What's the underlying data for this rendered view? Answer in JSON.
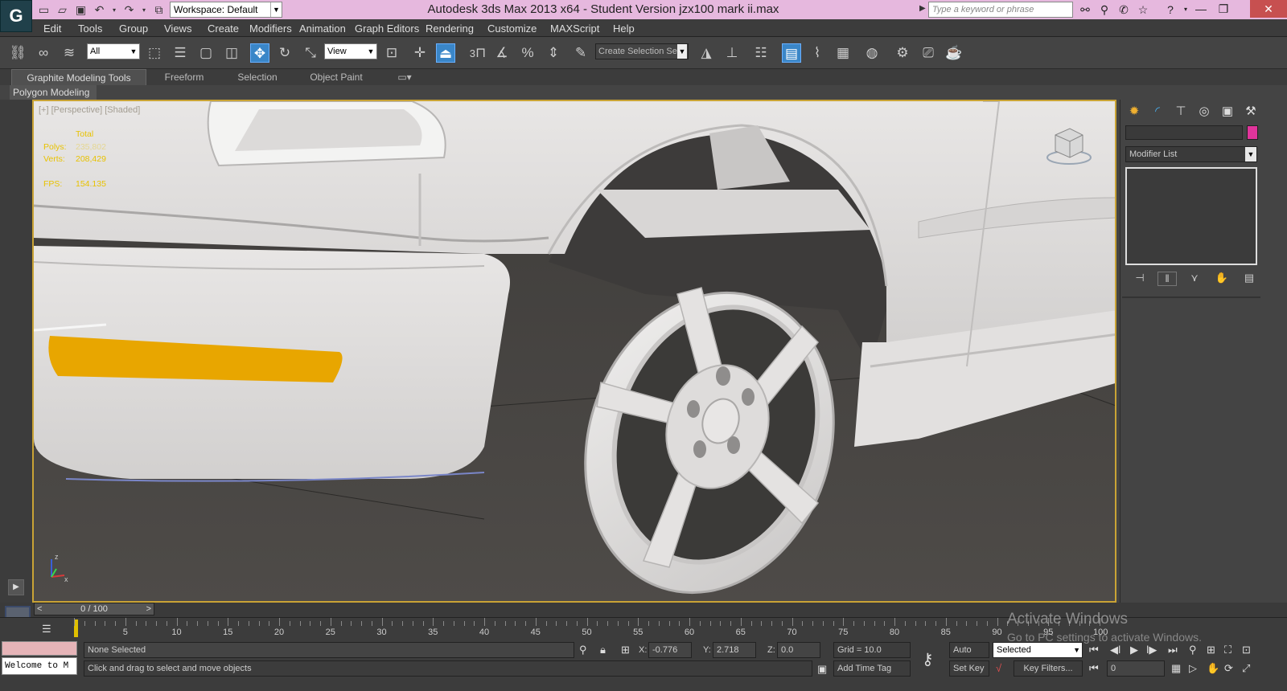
{
  "app": {
    "title": "Autodesk 3ds Max  2013 x64  - Student Version    jzx100 mark ii.max",
    "logo_letter": "G",
    "workspace": "Workspace: Default",
    "search_placeholder": "Type a keyword or phrase"
  },
  "menu": [
    "Edit",
    "Tools",
    "Group",
    "Views",
    "Create",
    "Modifiers",
    "Animation",
    "Graph Editors",
    "Rendering",
    "Customize",
    "MAXScript",
    "Help"
  ],
  "toolbar": {
    "filter_value": "All",
    "ref_coord_value": "View",
    "selection_set_value": "Create Selection Se",
    "snap_count": "3",
    "angle_snap": "%"
  },
  "ribbon": {
    "tabs": [
      "Graphite Modeling Tools",
      "Freeform",
      "Selection",
      "Object Paint"
    ],
    "active_tab": "Graphite Modeling Tools",
    "panel_label": "Polygon Modeling"
  },
  "viewport": {
    "label": "[+] [Perspective] [Shaded]",
    "stats": {
      "total_label": "Total",
      "polys_label": "Polys:",
      "polys_value": "235,802",
      "verts_label": "Verts:",
      "verts_value": "208,429",
      "fps_label": "FPS:",
      "fps_value": "154.135"
    },
    "axis_x": "x",
    "axis_z": "z"
  },
  "command_panel": {
    "modifier_list": "Modifier List",
    "object_color": "#e0349b"
  },
  "timeline": {
    "slider_label": "0 / 100",
    "ticks": [
      "5",
      "10",
      "15",
      "20",
      "25",
      "30",
      "35",
      "40",
      "45",
      "50",
      "55",
      "60",
      "65",
      "70",
      "75",
      "80",
      "85",
      "90",
      "95",
      "100"
    ]
  },
  "status": {
    "maxscript_text": "Welcome to M",
    "selection_status": "None Selected",
    "prompt": "Click and drag to select and move objects",
    "x_label": "X:",
    "x_value": "-0.776",
    "y_label": "Y:",
    "y_value": "2.718",
    "z_label": "Z:",
    "z_value": "0.0",
    "grid": "Grid = 10.0",
    "add_time_tag": "Add Time Tag",
    "auto_key": "Auto Key",
    "set_key": "Set Key",
    "key_mode": "Selected",
    "key_filters": "Key Filters...",
    "frame_value": "0"
  },
  "watermark": {
    "line1": "Activate Windows",
    "line2": "Go to PC settings to activate Windows."
  }
}
